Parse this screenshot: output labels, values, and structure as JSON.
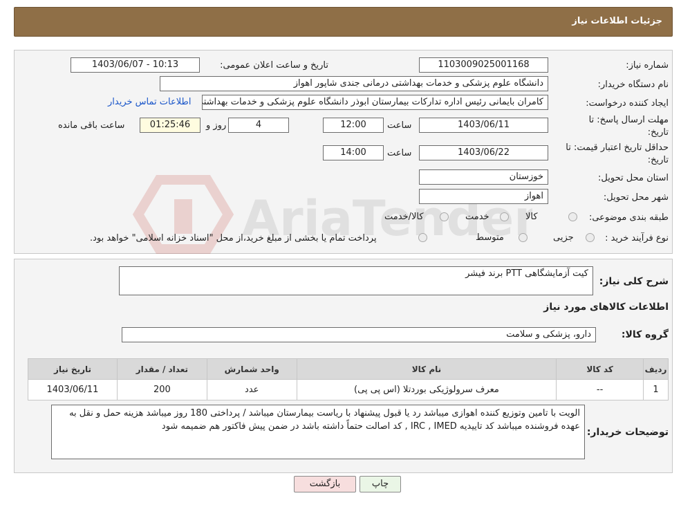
{
  "header": {
    "title": "جزئیات اطلاعات نیاز"
  },
  "fields": {
    "need_number_label": "شماره نیاز:",
    "need_number": "1103009025001168",
    "announce_label": "تاریخ و ساعت اعلان عمومی:",
    "announce_value": "1403/06/07 - 10:13",
    "buyer_org_label": "نام دستگاه خریدار:",
    "buyer_org": "دانشگاه علوم پزشکی و خدمات بهداشتی درمانی جندی شاپور اهواز",
    "creator_label": "ایجاد کننده درخواست:",
    "creator": "کامران بایمانی رئیس اداره تدارکات بیمارستان ابوذر  دانشگاه علوم پزشکی و خدمات بهداشتی",
    "contact_link": "اطلاعات تماس خریدار",
    "deadline_label": "مهلت ارسال پاسخ: تا",
    "deadline_label2": "تاریخ:",
    "deadline_date": "1403/06/11",
    "time_word": "ساعت",
    "deadline_time": "12:00",
    "days_value": "4",
    "days_word": "روز و",
    "remaining_time": "01:25:46",
    "remaining_word": "ساعت باقی مانده",
    "min_validity_label": "حداقل تاریخ اعتبار قیمت: تا",
    "min_validity_label2": "تاریخ:",
    "min_validity_date": "1403/06/22",
    "min_validity_time": "14:00",
    "province_label": "استان محل تحویل:",
    "province": "خوزستان",
    "city_label": "شهر محل تحویل:",
    "city": "اهواز",
    "category_label": "طبقه بندی موضوعی:",
    "category_options": [
      "کالا",
      "خدمت",
      "کالا/خدمت"
    ],
    "process_label": "نوع فرآیند خرید :",
    "process_options": [
      "جزیی",
      "متوسط"
    ],
    "process_note": "پرداخت تمام یا بخشی از مبلغ خرید،از محل \"اسناد خزانه اسلامی\" خواهد بود."
  },
  "section2": {
    "summary_label": "شرح کلی نیاز:",
    "summary": "کیت آزمایشگاهی PTT برند فیشر",
    "goods_info_title": "اطلاعات کالاهای مورد نیاز",
    "goods_group_label": "گروه کالا:",
    "goods_group": "دارو، پزشکی و سلامت",
    "table": {
      "headers": [
        "ردیف",
        "کد کالا",
        "نام کالا",
        "واحد شمارش",
        "تعداد / مقدار",
        "تاریخ نیاز"
      ],
      "rows": [
        [
          "1",
          "--",
          "معرف سرولوژیکی بوردتلا (اس پی پی)",
          "عدد",
          "200",
          "1403/06/11"
        ]
      ]
    },
    "buyer_notes_label": "توضیحات خریدار:",
    "buyer_notes": "الویت با تامین وتوزیع کننده اهوازی  میباشد رد یا قبول پیشنهاد با ریاست بیمارستان میباشد / پرداختی 180 روز   میباشد هزینه حمل و نقل به عهده فروشنده میباشد   کد تاییدیه IRC , IMED , کد اصالت حتماً داشته باشد در ضمن پیش فاکتور هم ضمیمه شود"
  },
  "buttons": {
    "print": "چاپ",
    "back": "بازگشت"
  },
  "watermark": {
    "text": "AriaTender.neT"
  }
}
